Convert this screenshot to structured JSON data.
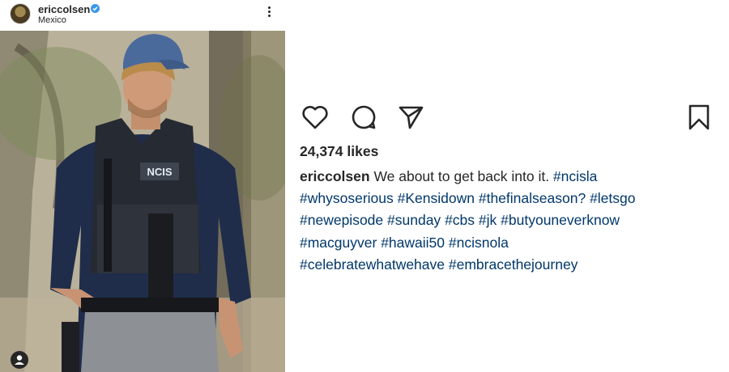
{
  "post": {
    "username": "ericcolsen",
    "location": "Mexico",
    "likes": "24,374 likes",
    "caption_text": " We about to get back into it. ",
    "hashtags": {
      "ncisla": "#ncisla",
      "whysoserious": "#whysoserious",
      "kensidown": "#Kensidown",
      "finalseason": "#thefinalseason?",
      "letsgo": "#letsgo",
      "newepisode": "#newepisode",
      "sunday": "#sunday",
      "cbs": "#cbs",
      "jk": "#jk",
      "butyouneverknow": "#butyouneverknow",
      "macguyver": "#macguyver",
      "hawaii50": "#hawaii50",
      "ncisnola": "#ncisnola",
      "celebrate": "#celebratewhatwehave",
      "embrace": "#embracethejourney"
    },
    "vest_patch": "NCIS"
  },
  "icons": {
    "verified": "verified-badge-icon",
    "more": "more-options-icon",
    "like": "heart-icon",
    "comment": "comment-icon",
    "share": "send-icon",
    "save": "bookmark-icon",
    "tag": "user-tag-icon"
  },
  "colors": {
    "hashtag": "#00376b",
    "verified": "#3897f0",
    "text": "#262626"
  }
}
